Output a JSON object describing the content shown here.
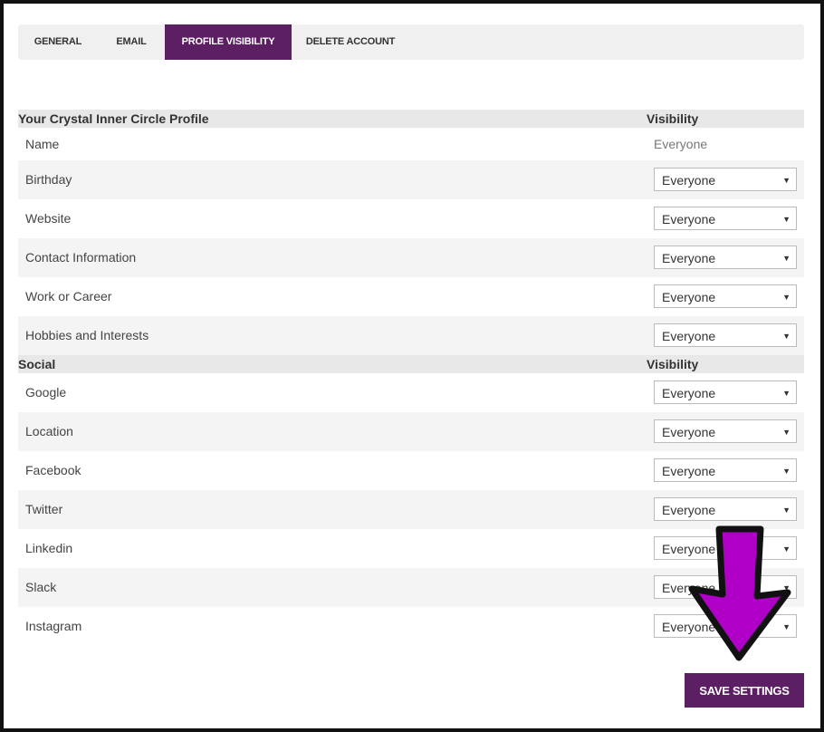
{
  "tabs": [
    {
      "label": "GENERAL"
    },
    {
      "label": "EMAIL"
    },
    {
      "label": "PROFILE VISIBILITY"
    },
    {
      "label": "DELETE ACCOUNT"
    }
  ],
  "profile_section": {
    "title": "Your Crystal Inner Circle Profile",
    "visibility_header": "Visibility",
    "rows": [
      {
        "label": "Name",
        "value": "Everyone"
      },
      {
        "label": "Birthday",
        "value": "Everyone"
      },
      {
        "label": "Website",
        "value": "Everyone"
      },
      {
        "label": "Contact Information",
        "value": "Everyone"
      },
      {
        "label": "Work or Career",
        "value": "Everyone"
      },
      {
        "label": "Hobbies and Interests",
        "value": "Everyone"
      }
    ]
  },
  "social_section": {
    "title": "Social",
    "visibility_header": "Visibility",
    "rows": [
      {
        "label": "Google",
        "value": "Everyone"
      },
      {
        "label": "Location",
        "value": "Everyone"
      },
      {
        "label": "Facebook",
        "value": "Everyone"
      },
      {
        "label": "Twitter",
        "value": "Everyone"
      },
      {
        "label": "Linkedin",
        "value": "Everyone"
      },
      {
        "label": "Slack",
        "value": "Everyone"
      },
      {
        "label": "Instagram",
        "value": "Everyone"
      }
    ]
  },
  "save_label": "SAVE SETTINGS",
  "colors": {
    "accent": "#5d1f63",
    "annotation_arrow": "#b000c8"
  }
}
